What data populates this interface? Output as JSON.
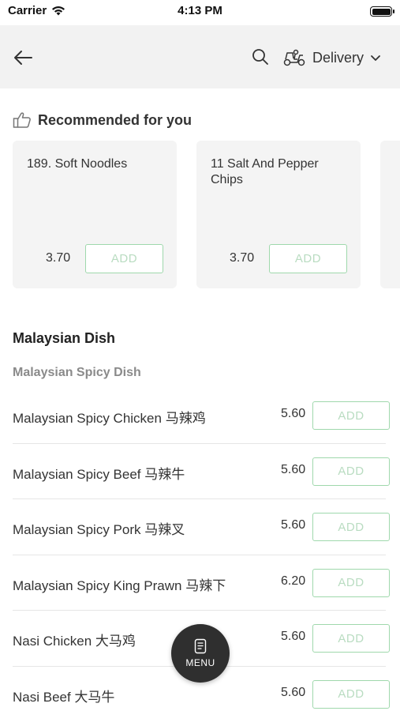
{
  "status_bar": {
    "carrier": "Carrier",
    "time": "4:13 PM"
  },
  "header": {
    "back_icon": "arrow-left-icon",
    "search_icon": "search-icon",
    "delivery_icon": "scooter-icon",
    "delivery_label": "Delivery",
    "dropdown_icon": "chevron-down-icon"
  },
  "recommended": {
    "title": "Recommended for you",
    "icon": "thumbs-up-icon",
    "items": [
      {
        "name": "189. Soft Noodles",
        "price": "3.70",
        "add_label": "ADD"
      },
      {
        "name": "11 Salt And Pepper Chips",
        "price": "3.70",
        "add_label": "ADD"
      }
    ]
  },
  "section": {
    "title": "Malaysian Dish",
    "subtitle": "Malaysian Spicy Dish",
    "items": [
      {
        "name": "Malaysian Spicy Chicken 马辣鸡",
        "price": "5.60",
        "add_label": "ADD"
      },
      {
        "name": "Malaysian Spicy Beef 马辣牛",
        "price": "5.60",
        "add_label": "ADD"
      },
      {
        "name": "Malaysian Spicy Pork 马辣叉",
        "price": "5.60",
        "add_label": "ADD"
      },
      {
        "name": "Malaysian Spicy King Prawn 马辣下",
        "price": "6.20",
        "add_label": "ADD"
      },
      {
        "name": "Nasi Chicken 大马鸡",
        "price": "5.60",
        "add_label": "ADD"
      },
      {
        "name": "Nasi Beef 大马牛",
        "price": "5.60",
        "add_label": "ADD"
      }
    ]
  },
  "fab": {
    "label": "MENU",
    "icon": "menu-card-icon"
  },
  "colors": {
    "header_bg": "#f2f2f2",
    "card_bg": "#f4f4f4",
    "add_border": "#9fd8ac",
    "add_text": "#b9dcc1",
    "fab_bg": "#2f2f2f"
  }
}
